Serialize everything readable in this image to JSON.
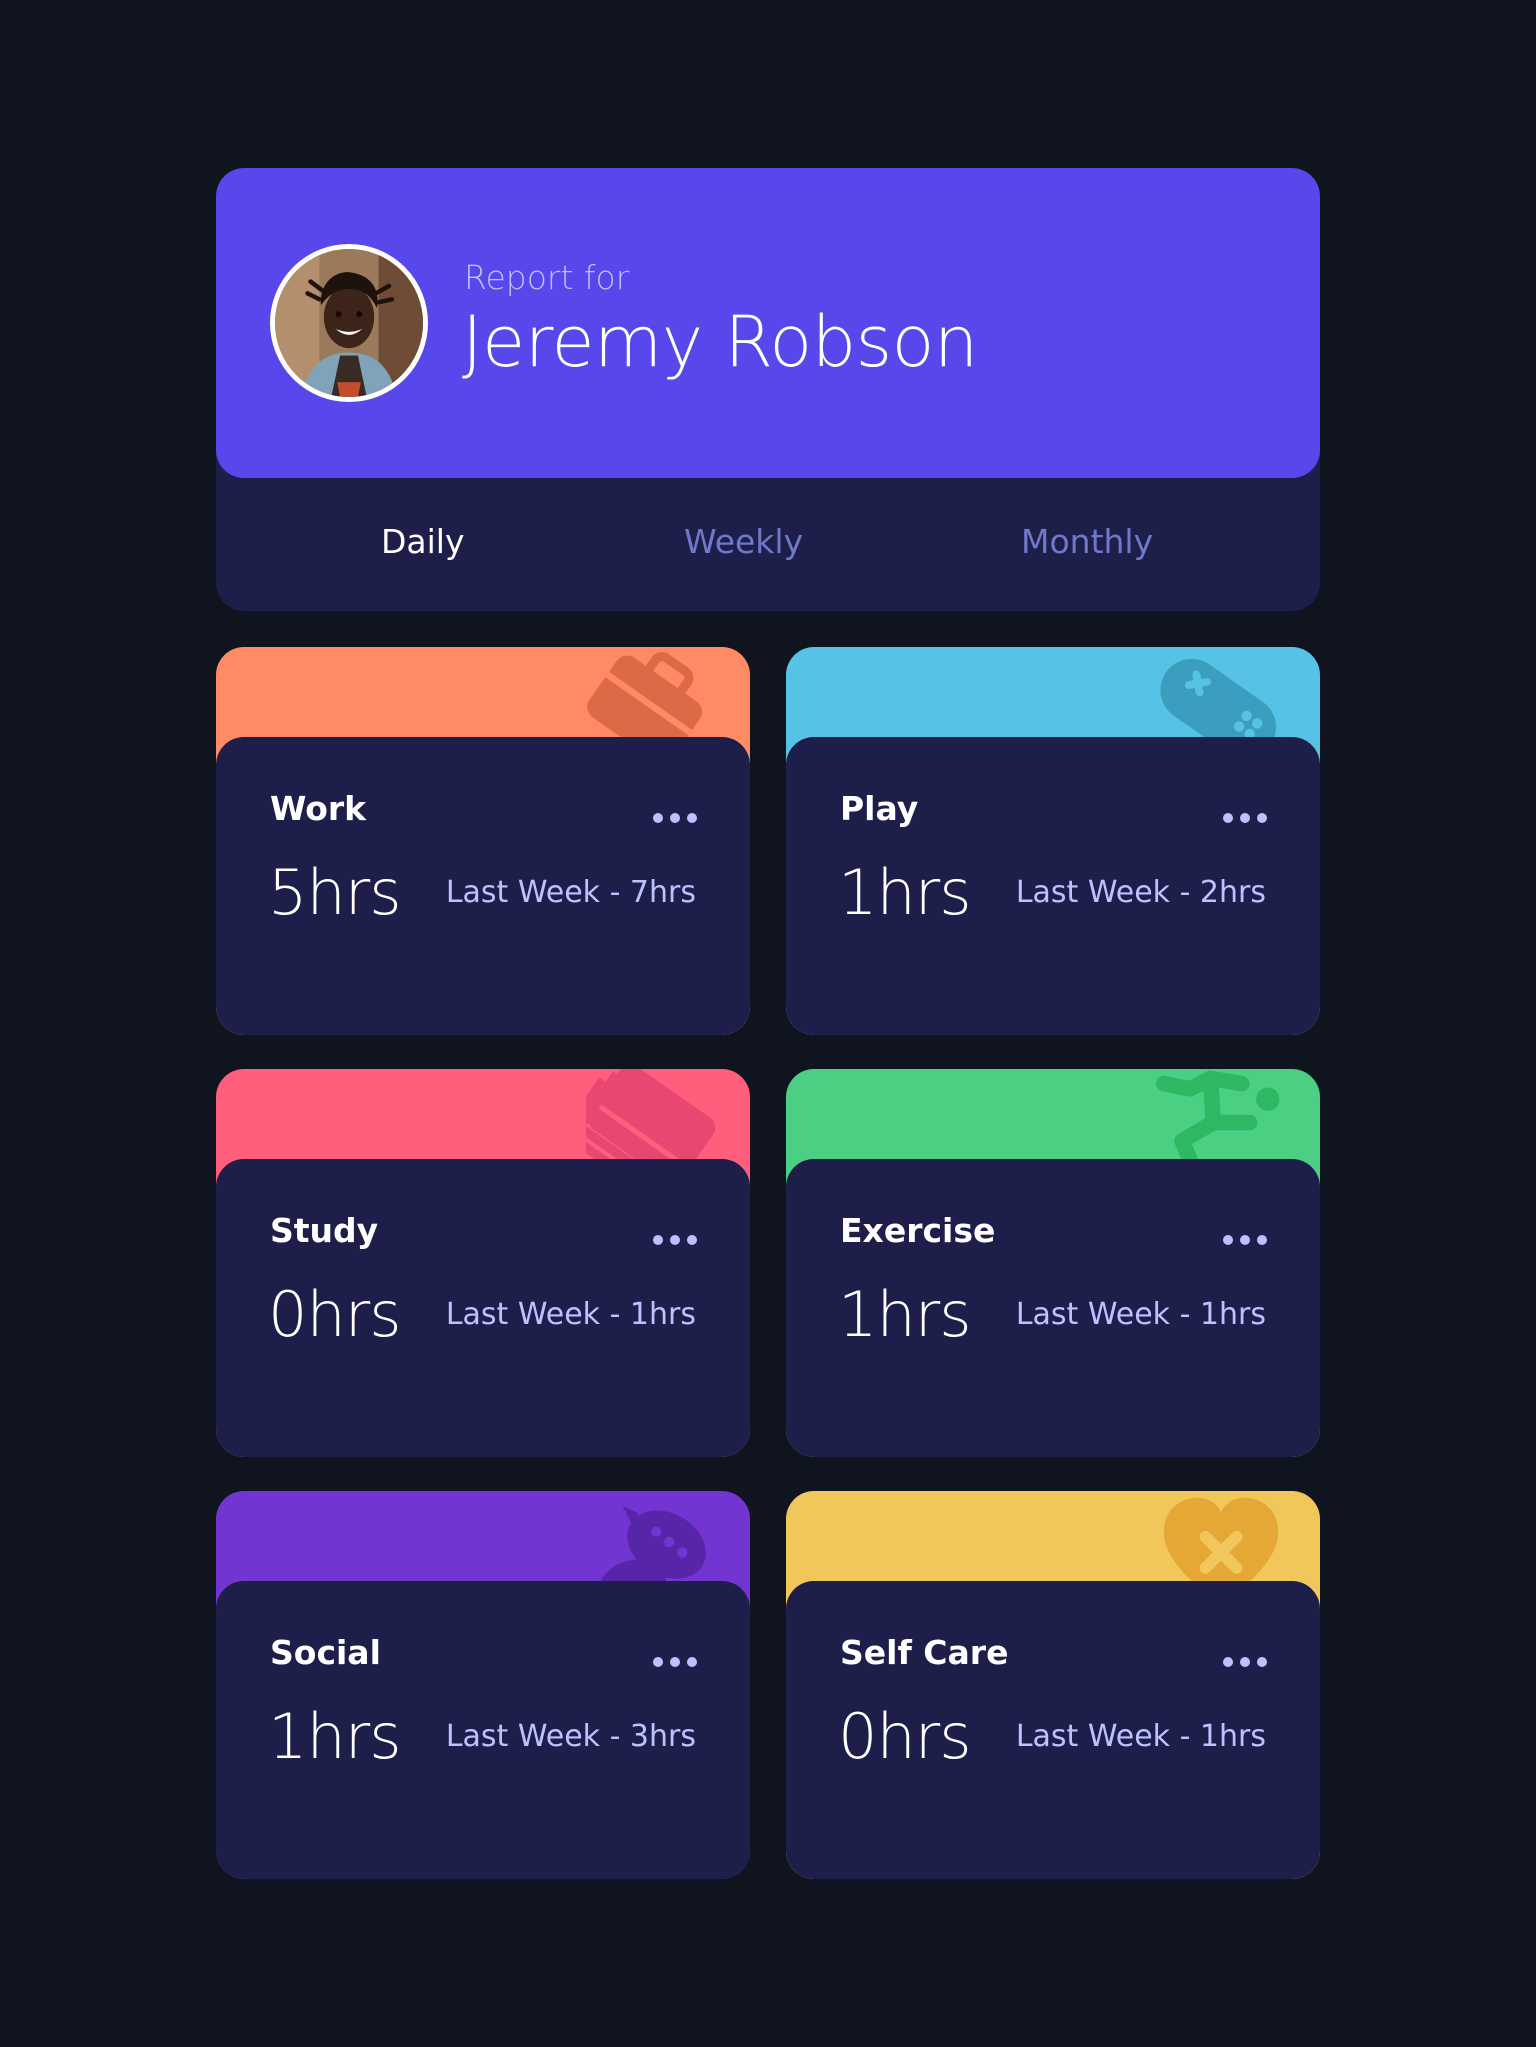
{
  "profile": {
    "report_label": "Report for",
    "name": "Jeremy Robson",
    "avatar": "user-avatar-photo"
  },
  "tabs": [
    {
      "label": "Daily",
      "active": true
    },
    {
      "label": "Weekly",
      "active": false
    },
    {
      "label": "Monthly",
      "active": false
    }
  ],
  "colors": {
    "background": "#10141f",
    "card": "#1d1f4a",
    "profile_accent": "#5847eb",
    "muted_text": "#bdc1ff",
    "tab_inactive": "#7078c9"
  },
  "activities": [
    {
      "title": "Work",
      "current": "5hrs",
      "previous": "Last Week - 7hrs",
      "icon": "briefcase-icon",
      "color": "#ff8b64"
    },
    {
      "title": "Play",
      "current": "1hrs",
      "previous": "Last Week - 2hrs",
      "icon": "gamepad-icon",
      "color": "#55c2e6"
    },
    {
      "title": "Study",
      "current": "0hrs",
      "previous": "Last Week - 1hrs",
      "icon": "book-icon",
      "color": "#ff5e7d"
    },
    {
      "title": "Exercise",
      "current": "1hrs",
      "previous": "Last Week - 1hrs",
      "icon": "running-person-icon",
      "color": "#4bcf82"
    },
    {
      "title": "Social",
      "current": "1hrs",
      "previous": "Last Week - 3hrs",
      "icon": "chat-bubbles-icon",
      "color": "#7335d2"
    },
    {
      "title": "Self Care",
      "current": "0hrs",
      "previous": "Last Week - 1hrs",
      "icon": "heart-bandage-icon",
      "color": "#f1c75b"
    }
  ],
  "menu_icon": "ellipsis-icon"
}
